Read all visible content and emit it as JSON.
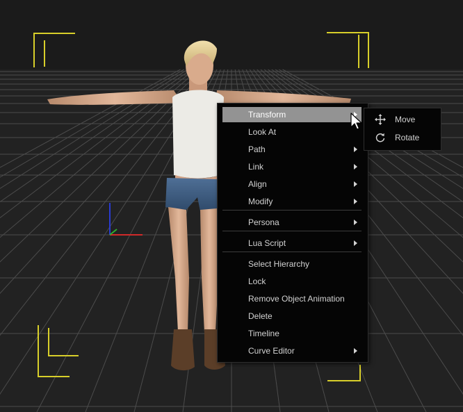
{
  "viewport": {
    "background": "#1c1c1c",
    "grid_color": "#555555",
    "frame_marker_color": "#d8cf2a",
    "gizmo_colors": {
      "x": "#d12a2a",
      "y": "#2a3bd1",
      "z": "#2fb02f"
    }
  },
  "context_menu": {
    "items": [
      {
        "label": "Transform",
        "submenu": true,
        "active": true
      },
      {
        "label": "Look At",
        "submenu": false
      },
      {
        "label": "Path",
        "submenu": true
      },
      {
        "label": "Link",
        "submenu": true
      },
      {
        "label": "Align",
        "submenu": true
      },
      {
        "label": "Modify",
        "submenu": true
      },
      {
        "label": "Persona",
        "submenu": true
      },
      {
        "label": "Lua Script",
        "submenu": true
      },
      {
        "label": "Select Hierarchy",
        "submenu": false
      },
      {
        "label": "Lock",
        "submenu": false
      },
      {
        "label": "Remove Object Animation",
        "submenu": false
      },
      {
        "label": "Delete",
        "submenu": false
      },
      {
        "label": "Timeline",
        "submenu": false
      },
      {
        "label": "Curve Editor",
        "submenu": true
      }
    ]
  },
  "transform_submenu": {
    "items": [
      {
        "label": "Move",
        "icon": "move-icon"
      },
      {
        "label": "Rotate",
        "icon": "rotate-icon"
      }
    ]
  }
}
